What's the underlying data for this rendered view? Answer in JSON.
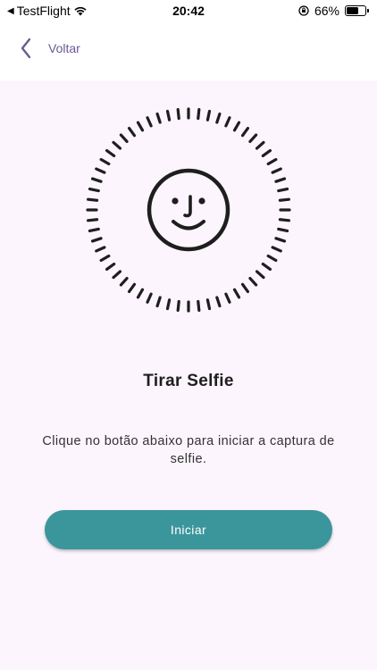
{
  "status_bar": {
    "carrier": "TestFlight",
    "time": "20:42",
    "battery_percent": "66%",
    "battery_level": 0.66
  },
  "header": {
    "back_label": "Voltar"
  },
  "main": {
    "title": "Tirar Selfie",
    "description": "Clique no botão abaixo para iniciar a captura de selfie.",
    "start_button": "Iniciar"
  },
  "colors": {
    "accent": "#3b969b",
    "back": "#6b5a94",
    "background": "#fcf5fd"
  },
  "icons": [
    "chevron-left-icon",
    "face-id-icon",
    "wifi-icon",
    "orientation-lock-icon",
    "battery-icon"
  ]
}
